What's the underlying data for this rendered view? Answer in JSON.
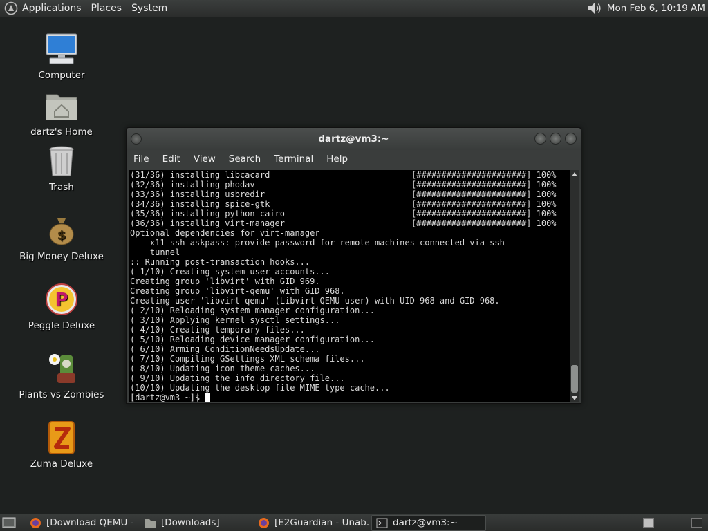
{
  "top_panel": {
    "menu_applications": "Applications",
    "menu_places": "Places",
    "menu_system": "System",
    "clock": "Mon Feb  6, 10:19 AM"
  },
  "desktop": {
    "icons": [
      {
        "label": "Computer"
      },
      {
        "label": "dartz's Home"
      },
      {
        "label": "Trash"
      },
      {
        "label": "Big Money Deluxe"
      },
      {
        "label": "Peggle Deluxe"
      },
      {
        "label": "Plants vs Zombies"
      },
      {
        "label": "Zuma Deluxe"
      }
    ]
  },
  "terminal": {
    "title": "dartz@vm3:~",
    "menu": [
      "File",
      "Edit",
      "View",
      "Search",
      "Terminal",
      "Help"
    ],
    "lines": [
      {
        "text": "(31/36) installing libcacard",
        "progress": "[######################] 100%"
      },
      {
        "text": "(32/36) installing phodav",
        "progress": "[######################] 100%"
      },
      {
        "text": "(33/36) installing usbredir",
        "progress": "[######################] 100%"
      },
      {
        "text": "(34/36) installing spice-gtk",
        "progress": "[######################] 100%"
      },
      {
        "text": "(35/36) installing python-cairo",
        "progress": "[######################] 100%"
      },
      {
        "text": "(36/36) installing virt-manager",
        "progress": "[######################] 100%"
      },
      {
        "text": "Optional dependencies for virt-manager",
        "progress": ""
      },
      {
        "text": "    x11-ssh-askpass: provide password for remote machines connected via ssh",
        "progress": ""
      },
      {
        "text": "    tunnel",
        "progress": ""
      },
      {
        "text": ":: Running post-transaction hooks...",
        "progress": ""
      },
      {
        "text": "( 1/10) Creating system user accounts...",
        "progress": ""
      },
      {
        "text": "Creating group 'libvirt' with GID 969.",
        "progress": ""
      },
      {
        "text": "Creating group 'libvirt-qemu' with GID 968.",
        "progress": ""
      },
      {
        "text": "Creating user 'libvirt-qemu' (Libvirt QEMU user) with UID 968 and GID 968.",
        "progress": ""
      },
      {
        "text": "( 2/10) Reloading system manager configuration...",
        "progress": ""
      },
      {
        "text": "( 3/10) Applying kernel sysctl settings...",
        "progress": ""
      },
      {
        "text": "( 4/10) Creating temporary files...",
        "progress": ""
      },
      {
        "text": "( 5/10) Reloading device manager configuration...",
        "progress": ""
      },
      {
        "text": "( 6/10) Arming ConditionNeedsUpdate...",
        "progress": ""
      },
      {
        "text": "( 7/10) Compiling GSettings XML schema files...",
        "progress": ""
      },
      {
        "text": "( 8/10) Updating icon theme caches...",
        "progress": ""
      },
      {
        "text": "( 9/10) Updating the info directory file...",
        "progress": ""
      },
      {
        "text": "(10/10) Updating the desktop file MIME type cache...",
        "progress": ""
      }
    ],
    "prompt": "[dartz@vm3 ~]$ "
  },
  "taskbar": {
    "tasks": [
      {
        "label": "[Download QEMU - ...",
        "icon": "firefox-icon",
        "active": false
      },
      {
        "label": "[Downloads]",
        "icon": "folder-icon",
        "active": false
      },
      {
        "label": "[E2Guardian - Unab...",
        "icon": "firefox-icon",
        "active": false
      },
      {
        "label": "dartz@vm3:~",
        "icon": "terminal-icon",
        "active": true
      }
    ]
  },
  "colors": {
    "desktop_bg": "#1e2120",
    "panel_bg": "#333635",
    "terminal_bg": "#000000",
    "terminal_fg": "#d8d8d8"
  }
}
